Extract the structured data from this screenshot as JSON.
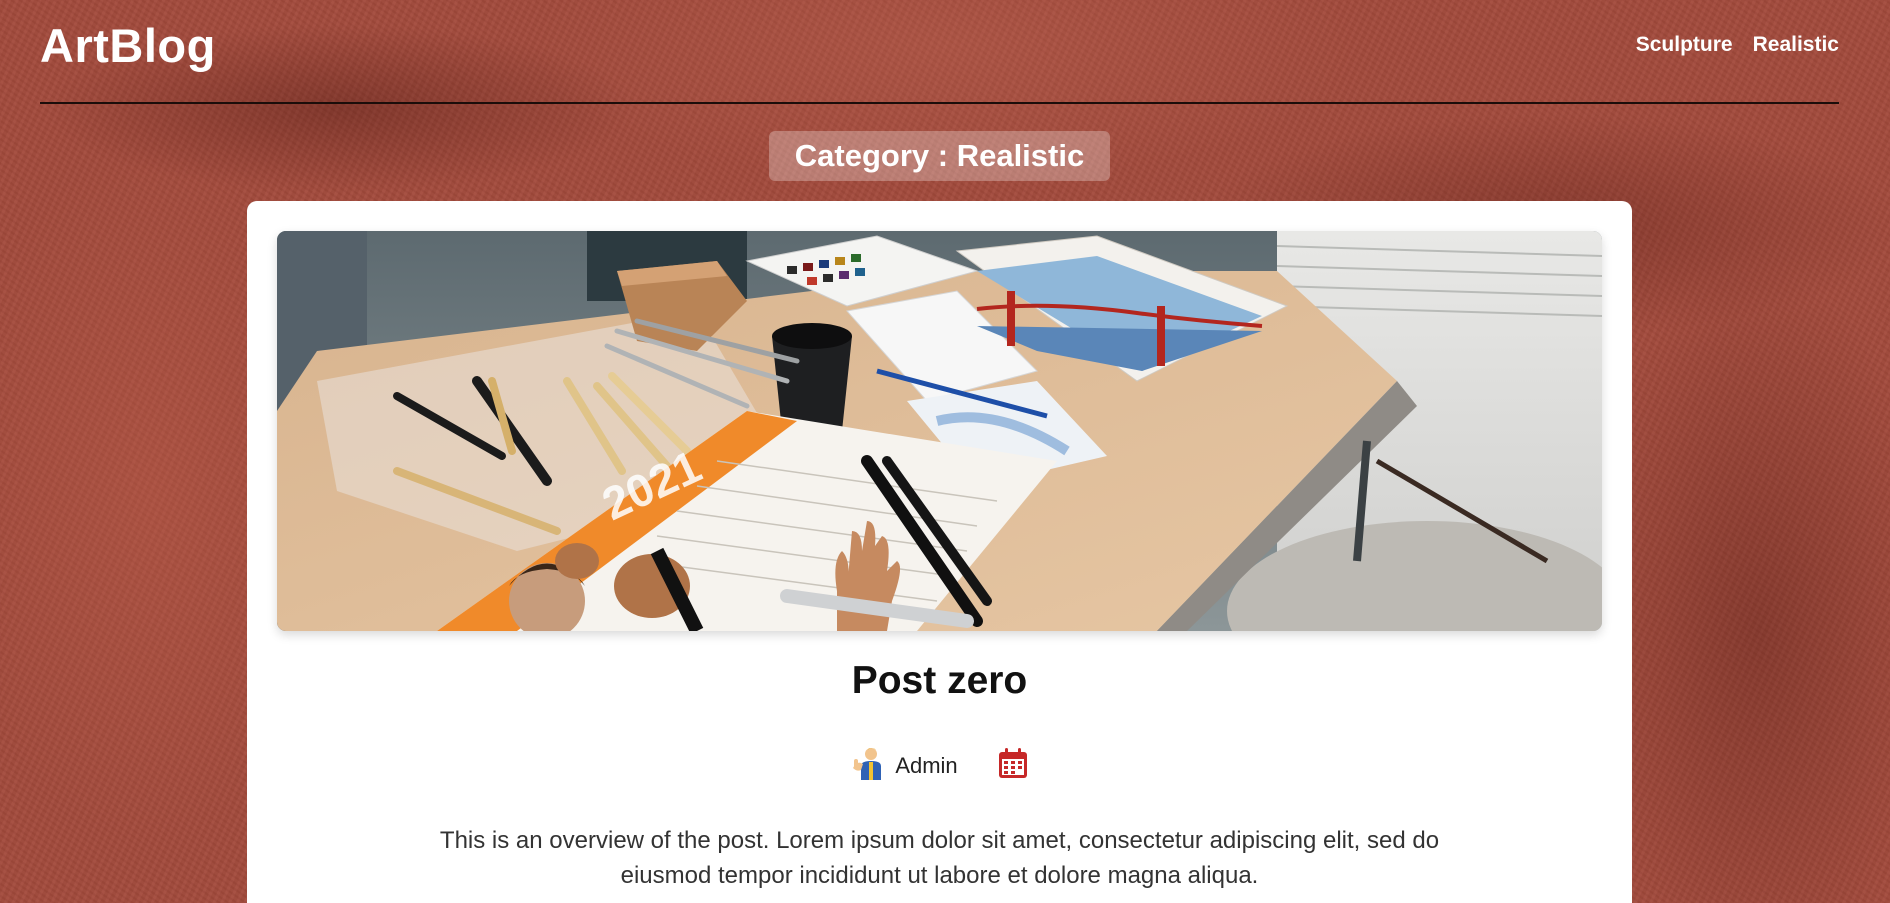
{
  "site": {
    "logo": "ArtBlog"
  },
  "nav": {
    "items": [
      {
        "label": "Sculpture"
      },
      {
        "label": "Realistic"
      }
    ]
  },
  "category": {
    "label": "Category : Realistic"
  },
  "post": {
    "title": "Post zero",
    "author": "Admin",
    "excerpt": "This is an overview of the post. Lorem ipsum dolor sit amet, consectetur adipiscing elit, sed do eiusmod tempor incididunt ut labore et dolore magna aliqua.",
    "image_alt": "Art desk with sculpting tools, watercolor palette, brushes and a painting of the Golden Gate Bridge",
    "icons": {
      "author": "admin-avatar-icon",
      "date": "calendar-icon"
    }
  },
  "colors": {
    "background": "#a34a3c",
    "card": "#ffffff",
    "calendar": "#c62828"
  }
}
